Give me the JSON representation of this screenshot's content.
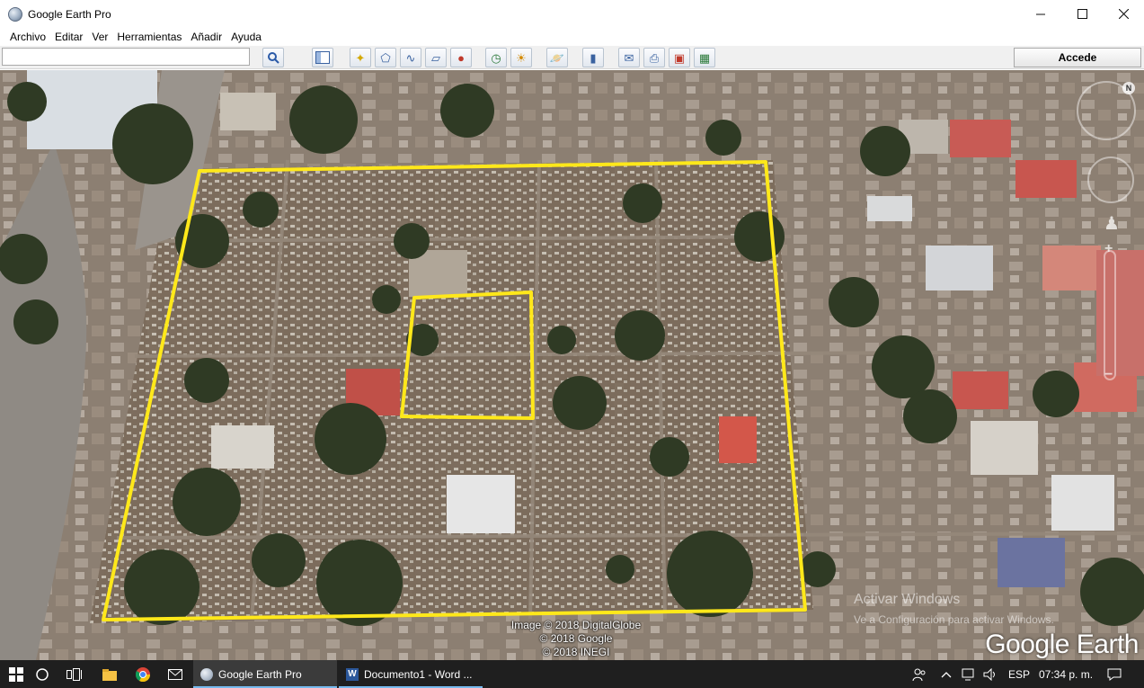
{
  "window": {
    "title": "Google Earth Pro",
    "minimize_icon": "minimize-icon",
    "maximize_icon": "maximize-icon",
    "close_icon": "close-icon"
  },
  "menu": {
    "items": [
      "Archivo",
      "Editar",
      "Ver",
      "Herramientas",
      "Añadir",
      "Ayuda"
    ]
  },
  "toolbar": {
    "search_value": "",
    "search_button_icon": "magnifier-icon",
    "accede_label": "Accede",
    "tools": [
      "sidebar-toggle-icon",
      "add-placemark-icon",
      "add-polygon-icon",
      "add-path-icon",
      "add-image-overlay-icon",
      "record-tour-icon",
      "historical-imagery-icon",
      "sunlight-icon",
      "switch-planet-icon",
      "ruler-icon",
      "email-icon",
      "print-icon",
      "save-image-icon",
      "view-in-maps-icon"
    ]
  },
  "map": {
    "attribution": [
      "Image © 2018 DigitalGlobe",
      "© 2018 Google",
      "© 2018 INEGI"
    ],
    "watermark_line1": "Activar Windows",
    "watermark_line2": "Ve a Configuración para activar Windows.",
    "logo": "Google Earth",
    "north_label": "N",
    "annotation_color": "#ffe81a"
  },
  "taskbar": {
    "apps": [
      {
        "label": "Google Earth Pro",
        "icon": "google-earth-icon",
        "active": true
      },
      {
        "label": "Documento1 - Word ...",
        "icon": "word-icon",
        "active": false
      }
    ],
    "language": "ESP",
    "time": "07:34 p. m."
  }
}
